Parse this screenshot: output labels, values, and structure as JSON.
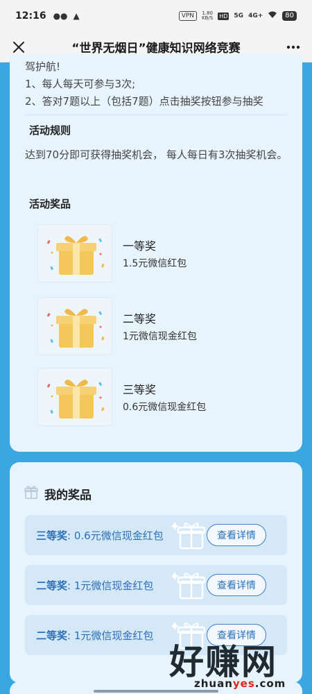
{
  "status": {
    "time": "12:16",
    "vpn": "VPN",
    "speed_top": "1.80",
    "speed_bottom": "KB/S",
    "hd": "HD",
    "net1": "5G",
    "net2": "4G+",
    "battery": "80"
  },
  "titlebar": {
    "title": "“世界无烟日”健康知识网络竞赛"
  },
  "intro": {
    "line1": "驾护航!",
    "line2": "1、每人每天可参与3次;",
    "line3": "2、答对7题以上（包括7题）点击抽奖按钮参与抽奖"
  },
  "rules": {
    "title": "活动规则",
    "text": "达到70分即可获得抽奖机会， 每人每日有3次抽奖机会。"
  },
  "prizes": {
    "title": "活动奖品",
    "items": [
      {
        "name": "一等奖",
        "desc": "1.5元微信红包"
      },
      {
        "name": "二等奖",
        "desc": "1元微信现金红包"
      },
      {
        "name": "三等奖",
        "desc": "0.6元微信现金红包"
      }
    ]
  },
  "my_prizes": {
    "title": "我的奖品",
    "records": [
      {
        "level": "三等奖",
        "sep": ":",
        "desc": "0.6元微信现金红包",
        "button": "查看详情"
      },
      {
        "level": "二等奖",
        "sep": ":",
        "desc": "1元微信现金红包",
        "button": "查看详情"
      },
      {
        "level": "二等奖",
        "sep": ":",
        "desc": "1元微信现金红包",
        "button": "查看详情"
      }
    ]
  },
  "watermark": {
    "big": "好赚网",
    "url_a": "zhuan",
    "url_b": "yes",
    "url_c": ".com"
  },
  "colors": {
    "page_bg": "#3aa7e3",
    "card_bg": "#e8f4fd",
    "accent_blue": "#2b6fb8",
    "gift_gold": "#f4c75a"
  }
}
